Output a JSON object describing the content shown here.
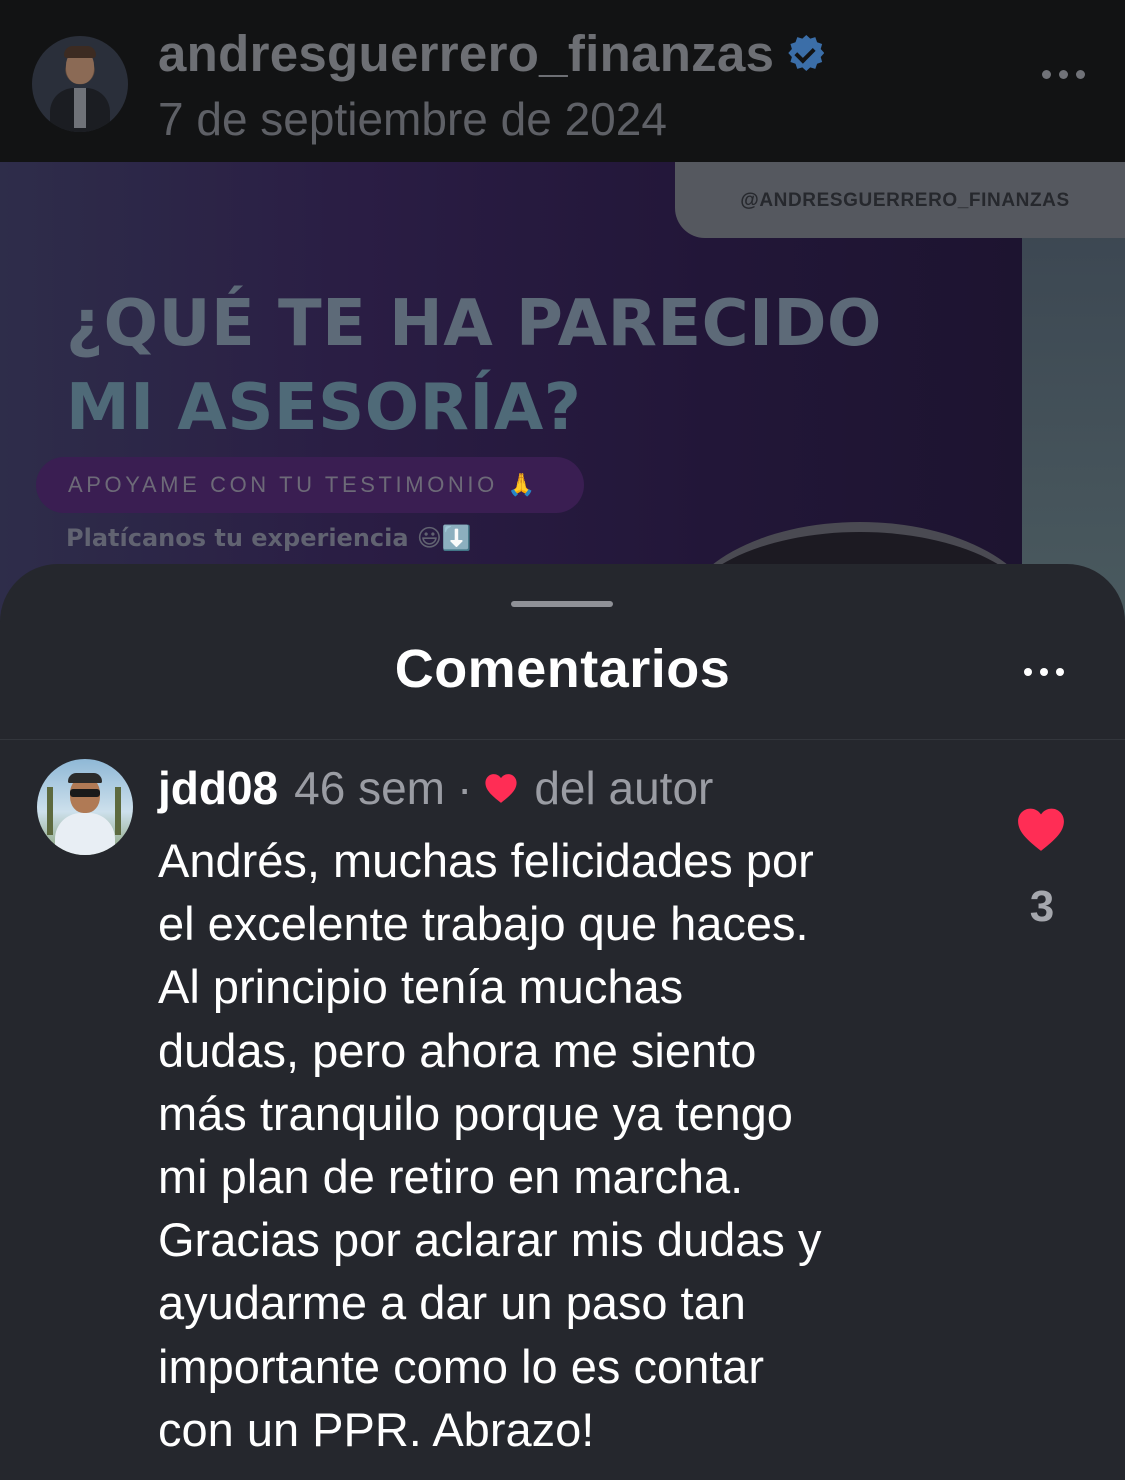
{
  "post": {
    "username": "andresguerrero_finanzas",
    "date": "7 de septiembre de 2024",
    "image": {
      "handle": "@ANDRESGUERRERO_FINANZAS",
      "title_line1": "¿QUÉ TE HA PARECIDO",
      "title_line2": "MI ASESORÍA?",
      "button_text": "APOYAME CON TU TESTIMONIO 🙏",
      "subtitle": "Platícanos tu experiencia 😃⬇️"
    }
  },
  "comments_sheet": {
    "title": "Comentarios"
  },
  "comment": {
    "username": "jdd08",
    "time": "46 sem",
    "separator": "·",
    "author_badge": "del autor",
    "text": "Andrés, muchas felicidades por\nel excelente trabajo que haces.\nAl principio tenía muchas\ndudas, pero ahora me siento\nmás tranquilo porque ya tengo\nmi plan de retiro en marcha.\nGracias por aclarar mis dudas y\nayudarme a dar un paso tan\nimportante como lo es contar\ncon un PPR. Abrazo!",
    "like_count": "3"
  },
  "colors": {
    "heart": "#ff2d55",
    "verified": "#3b6ea8",
    "sheet_bg": "#25272d"
  },
  "icons": [
    "verified-badge-icon",
    "more-options-icon",
    "heart-icon"
  ]
}
